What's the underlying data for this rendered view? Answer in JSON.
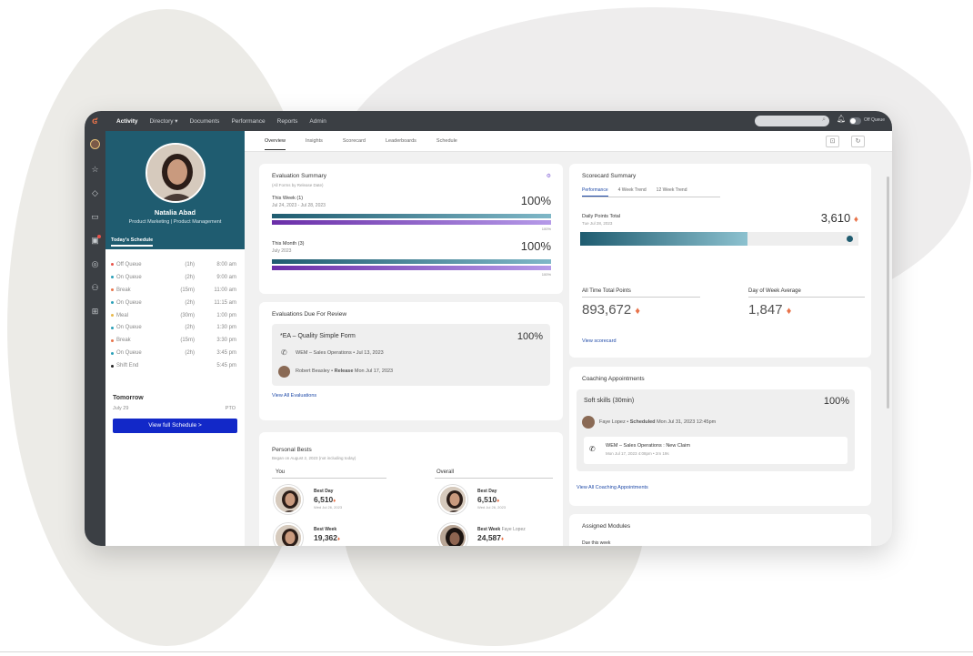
{
  "topnav": {
    "items": [
      "Activity",
      "Directory ▾",
      "Documents",
      "Performance",
      "Reports",
      "Admin"
    ],
    "queue_label": "Off Queue"
  },
  "profile": {
    "name": "Natalia Abad",
    "title": "Product Marketing | Product Management",
    "tab": "Today's Schedule"
  },
  "schedule": [
    {
      "name": "Off Queue",
      "dur": "(1h)",
      "time": "8:00 am",
      "color": "#e8524a"
    },
    {
      "name": "On Queue",
      "dur": "(2h)",
      "time": "9:00 am",
      "color": "#2aa0b8"
    },
    {
      "name": "Break",
      "dur": "(15m)",
      "time": "11:00 am",
      "color": "#e8734a"
    },
    {
      "name": "On Queue",
      "dur": "(2h)",
      "time": "11:15 am",
      "color": "#2aa0b8"
    },
    {
      "name": "Meal",
      "dur": "(30m)",
      "time": "1:00 pm",
      "color": "#e8b84a"
    },
    {
      "name": "On Queue",
      "dur": "(2h)",
      "time": "1:30 pm",
      "color": "#2aa0b8"
    },
    {
      "name": "Break",
      "dur": "(15m)",
      "time": "3:30 pm",
      "color": "#e8734a"
    },
    {
      "name": "On Queue",
      "dur": "(2h)",
      "time": "3:45 pm",
      "color": "#2aa0b8"
    },
    {
      "name": "Shift End",
      "dur": "",
      "time": "5:45 pm",
      "color": "#222222"
    }
  ],
  "tomorrow": {
    "heading": "Tomorrow",
    "date": "July 29",
    "status": "PTO",
    "button": "View full Schedule >"
  },
  "subtabs": [
    "Overview",
    "Insights",
    "Scorecard",
    "Leaderboards",
    "Schedule"
  ],
  "eval_summary": {
    "title": "Evaluation Summary",
    "sub": "(All Forms by Release Date)",
    "week_label": "This Week (1)",
    "week_date": "Jul 24, 2023 - Jul 28, 2023",
    "week_pct": "100%",
    "week_bar_label": "100%",
    "month_label": "This Month (3)",
    "month_date": "July 2023",
    "month_pct": "100%",
    "month_bar_label": "100%",
    "week_progress": 1.0,
    "month_progress": 1.0
  },
  "evals_due": {
    "title": "Evaluations Due For Review",
    "form": "*EA – Quality Simple Form",
    "pct": "100%",
    "line": "WEM – Sales Operations • Jul 13, 2023",
    "person": "Robert Beasley",
    "release_label": "Release",
    "release_date": "Mon Jul 17, 2023",
    "link": "View All Evaluations"
  },
  "personal_bests": {
    "title": "Personal Bests",
    "sub": "Began on August 2, 2023 (not including today)",
    "you_label": "You",
    "overall_label": "Overall",
    "you_day_label": "Best Day",
    "you_day_value": "6,510",
    "you_day_date": "Wed Jul 26, 2023",
    "you_week_label": "Best Week",
    "you_week_value": "19,362",
    "overall_day_label": "Best Day",
    "overall_day_value": "6,510",
    "overall_day_date": "Wed Jul 26, 2023",
    "overall_week_label": "Best Week",
    "overall_week_who": "Faye Lopez",
    "overall_week_value": "24,587"
  },
  "scorecard": {
    "title": "Scorecard Summary",
    "tabs": [
      "Performance",
      "4 Week Trend",
      "12 Week Trend"
    ],
    "daily_label": "Daily Points Total",
    "daily_date": "Tue Jul 28, 2023",
    "daily_value": "3,610",
    "daily_progress": 0.6,
    "alltime_label": "All Time Total Points",
    "alltime_value": "893,672",
    "dow_label": "Day of Week Average",
    "dow_value": "1,847",
    "link": "View scorecard"
  },
  "coaching": {
    "title": "Coaching Appointments",
    "session": "Soft skills (30min)",
    "pct": "100%",
    "person": "Faye Lopez",
    "status": "Scheduled",
    "when": "Mon Jul 31, 2023 12:45pm",
    "claim": "WEM – Sales Operations : New Claim",
    "claim_when": "Mon Jul 17, 2023 4:08pm • 2m 19s",
    "link": "View All Coaching Appointments"
  },
  "modules": {
    "title": "Assigned Modules",
    "sub": "Due this week"
  },
  "colors": {
    "profile_bg": "#1f5c70",
    "nav_bg": "#3b3f44",
    "primary_button": "#1228c8",
    "link": "#1f4aa8",
    "gem": "#e8734a"
  }
}
